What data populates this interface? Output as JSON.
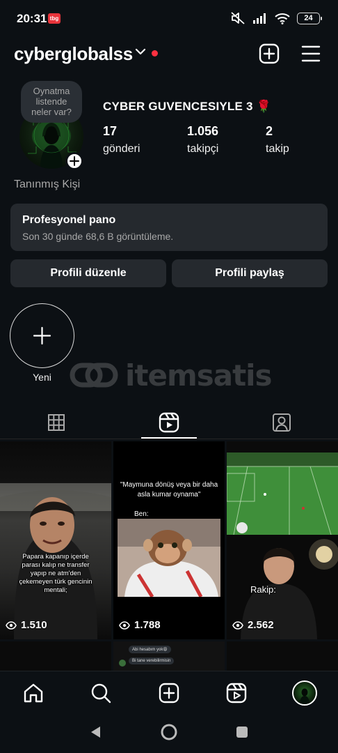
{
  "status_bar": {
    "time": "20:31",
    "notif_badge": "tbg",
    "battery": "24",
    "icons": [
      "mute-icon",
      "signal-icon",
      "wifi-icon",
      "battery-icon"
    ]
  },
  "header": {
    "username": "cyberglobalss",
    "icons": [
      "chevron-down-icon",
      "plus-square-icon",
      "menu-icon"
    ]
  },
  "profile": {
    "note": [
      "Oynatma",
      "listende",
      "neler var?"
    ],
    "display_name": "CYBER GUVENCESIYLE 3 🌹",
    "stats": [
      {
        "num": "17",
        "label": "gönderi"
      },
      {
        "num": "1.056",
        "label": "takipçi"
      },
      {
        "num": "2",
        "label": "takip"
      }
    ],
    "category": "Tanınmış Kişi"
  },
  "pro_panel": {
    "title": "Profesyonel pano",
    "subtitle": "Son 30 günde 68,6 B görüntüleme."
  },
  "buttons": {
    "edit": "Profili düzenle",
    "share": "Profili paylaş"
  },
  "highlights": {
    "new_label": "Yeni"
  },
  "watermark": {
    "text": "itemsatis"
  },
  "tabs": [
    "grid-icon",
    "reels-icon",
    "tagged-icon"
  ],
  "grid": [
    {
      "views": "1.510",
      "caption": [
        "Papara kapanıp içerde",
        "parası kalıp ne transfer",
        "yapıp ne atm'den",
        "çekemeyen türk gencinin",
        "mentali;"
      ]
    },
    {
      "views": "1.788",
      "caption": [
        "\"Maymuna dönüş veya bir daha",
        "asla kumar oynama\""
      ],
      "sub": "Ben:"
    },
    {
      "views": "2.562",
      "caption": [
        "Rakip:"
      ]
    }
  ],
  "grid_row2": {
    "chat": [
      "Abi hesabım yok😩",
      "Bi tane verebilirmisin"
    ]
  },
  "bottom_nav": [
    "home-icon",
    "search-icon",
    "create-icon",
    "reels-icon",
    "profile-avatar"
  ],
  "android_nav": [
    "back-icon",
    "home-button-icon",
    "recents-icon"
  ]
}
